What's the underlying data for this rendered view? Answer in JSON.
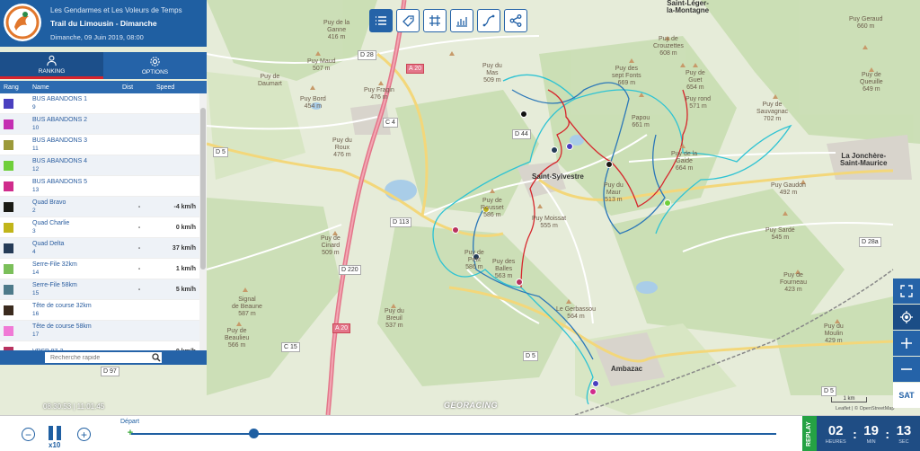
{
  "header": {
    "organizer": "Les Gendarmes et Les Voleurs de Temps",
    "title": "Trail du Limousin - Dimanche",
    "date": "Dimanche, 09 Juin 2019, 08:00"
  },
  "tabs": [
    {
      "label": "RANKING",
      "icon": "person-icon",
      "active": true
    },
    {
      "label": "OPTIONS",
      "icon": "gear-icon",
      "active": false
    }
  ],
  "list": {
    "headers": {
      "rang": "Rang",
      "name": "Name",
      "dist": "Dist",
      "speed": "Speed"
    },
    "rows": [
      {
        "name": "BUS ABANDONS 1",
        "number": "9",
        "color": "#4a3fbf",
        "dist": "",
        "speed": ""
      },
      {
        "name": "BUS ABANDONS 2",
        "number": "10",
        "color": "#c42fb2",
        "dist": "",
        "speed": ""
      },
      {
        "name": "BUS ABANDONS 3",
        "number": "11",
        "color": "#9c9a3a",
        "dist": "",
        "speed": ""
      },
      {
        "name": "BUS ABANDONS 4",
        "number": "12",
        "color": "#6fcf3a",
        "dist": "",
        "speed": ""
      },
      {
        "name": "BUS ABANDONS 5",
        "number": "13",
        "color": "#d02c8c",
        "dist": "",
        "speed": ""
      },
      {
        "name": "Quad Bravo",
        "number": "2",
        "color": "#1a1a14",
        "dist": "-",
        "speed": "-4 km/h"
      },
      {
        "name": "Quad Charlie",
        "number": "3",
        "color": "#c1b51a",
        "dist": "-",
        "speed": "0 km/h"
      },
      {
        "name": "Quad Delta",
        "number": "4",
        "color": "#253b57",
        "dist": "-",
        "speed": "37 km/h"
      },
      {
        "name": "Serre-File 32km",
        "number": "14",
        "color": "#7bbf5a",
        "dist": "-",
        "speed": "1 km/h"
      },
      {
        "name": "Serre-File 58km",
        "number": "15",
        "color": "#4d7a8a",
        "dist": "-",
        "speed": "5 km/h"
      },
      {
        "name": "Tête de course 32km",
        "number": "16",
        "color": "#3a2a1e",
        "dist": "",
        "speed": ""
      },
      {
        "name": "Tête de course 58km",
        "number": "17",
        "color": "#f07ad6",
        "dist": "",
        "speed": ""
      },
      {
        "name": "VPSP 87-2",
        "number": "",
        "color": "#b8325f",
        "dist": "-",
        "speed": "0 km/h"
      }
    ]
  },
  "search": {
    "placeholder": "Recherche rapide"
  },
  "toolbar": [
    {
      "name": "list-view-button",
      "icon": "list-icon",
      "active": true
    },
    {
      "name": "tag-button",
      "icon": "tag-icon",
      "active": false
    },
    {
      "name": "grid-button",
      "icon": "grid-icon",
      "active": false
    },
    {
      "name": "chart-button",
      "icon": "bar-chart-icon",
      "active": false
    },
    {
      "name": "route-button",
      "icon": "route-icon",
      "active": false
    },
    {
      "name": "share-button",
      "icon": "share-icon",
      "active": false
    }
  ],
  "map_controls": {
    "sat_label": "SAT"
  },
  "map": {
    "watermark": "GEORACING",
    "attribution": "Leaflet | © OpenStreetMap",
    "scale": "1 km",
    "cursor_time": "08:30:53 | 11:01:45",
    "places": [
      {
        "t": "Saint-Sylvestre",
        "town": true
      },
      {
        "t": "Ambazac",
        "town": true
      },
      {
        "t": "La Jonchère-\nSaint-Maurice",
        "town": true
      },
      {
        "t": "Saint-Léger-\nla-Montagne",
        "town": true
      },
      {
        "t": "Puy de\nRousset\n586 m",
        "town": false
      },
      {
        "t": "Puy Moissat\n555 m",
        "town": false
      },
      {
        "t": "Puy Gaudon\n492 m",
        "town": false
      },
      {
        "t": "Puy Sardé\n545 m",
        "town": false
      },
      {
        "t": "Puy de\nFourneau\n423 m",
        "town": false
      },
      {
        "t": "Le Gerbassou\n564 m",
        "town": false
      },
      {
        "t": "Puy des\nsept Fonts\n669 m",
        "town": false
      },
      {
        "t": "Puy de\nGuet\n654 m",
        "town": false
      },
      {
        "t": "Puy rond\n571 m",
        "town": false
      },
      {
        "t": "Puy de\nSauvagnac\n702 m",
        "town": false
      },
      {
        "t": "Papou\n661 m",
        "town": false
      },
      {
        "t": "Puy de la\nGaide\n664 m",
        "town": false
      },
      {
        "t": "Puy du\nMas\n509 m",
        "town": false
      },
      {
        "t": "Puy Maud\n507 m",
        "town": false
      },
      {
        "t": "Puy Bord\n454 m",
        "town": false
      },
      {
        "t": "Puy de\nDaumart",
        "town": false
      },
      {
        "t": "Puy Fragin\n476 m",
        "town": false
      },
      {
        "t": "Puy du\nRoux\n476 m",
        "town": false
      },
      {
        "t": "Puy de\nCinard\n509 m",
        "town": false
      },
      {
        "t": "Signal\nde Beaune\n587 m",
        "town": false
      },
      {
        "t": "Puy du\nBreuil\n537 m",
        "town": false
      },
      {
        "t": "Puy de\nBeaulieu\n566 m",
        "town": false
      },
      {
        "t": "Puy Geraud\n660 m",
        "town": false
      },
      {
        "t": "Puy de\nQueuille\n649 m",
        "town": false
      },
      {
        "t": "Puy de\nCrouzettes\n608 m",
        "town": false
      },
      {
        "t": "Puy de la\nGanne\n416 m",
        "town": false
      },
      {
        "t": "Puy du\nMoulin\n429 m",
        "town": false
      },
      {
        "t": "Puy de\nPetit\n586 m",
        "town": false
      },
      {
        "t": "Puy des\nBalles\n563 m",
        "town": false
      },
      {
        "t": "Puy du\nMaur\n513 m",
        "town": false
      }
    ],
    "roads": [
      "D 28",
      "A 20",
      "D 44",
      "C 4",
      "D 5",
      "D 113",
      "D 220",
      "A 20",
      "C 15",
      "D 5",
      "D 97",
      "D 28a",
      "D 5"
    ]
  },
  "playback": {
    "speed": "x10",
    "start_label": "Départ",
    "progress": 0.19,
    "replay_label": "REPLAY",
    "hours": "02",
    "minutes": "19",
    "seconds": "13",
    "hours_label": "HEURES",
    "minutes_label": "MIN",
    "seconds_label": "SEC"
  }
}
